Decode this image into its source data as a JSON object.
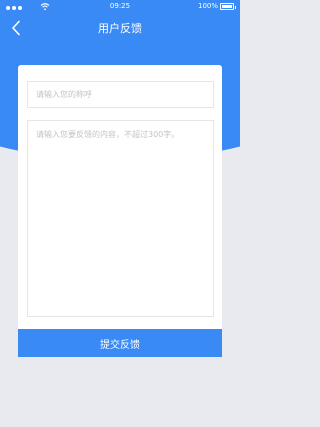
{
  "status_bar": {
    "time": "09:25",
    "battery": "100%",
    "icons": [
      "signal-dots-icon",
      "wifi-icon",
      "battery-icon"
    ]
  },
  "nav": {
    "title": "用户反馈",
    "back_icon": "chevron-left-icon"
  },
  "form": {
    "nickname_placeholder": "请输入您的称呼",
    "nickname_value": "",
    "content_placeholder": "请输入您要反馈的内容，不超过300字。",
    "content_value": ""
  },
  "submit_label": "提交反馈",
  "colors": {
    "accent": "#3a8af6",
    "background": "#e9eaf0",
    "card": "#ffffff",
    "placeholder": "#c3c3c3"
  }
}
